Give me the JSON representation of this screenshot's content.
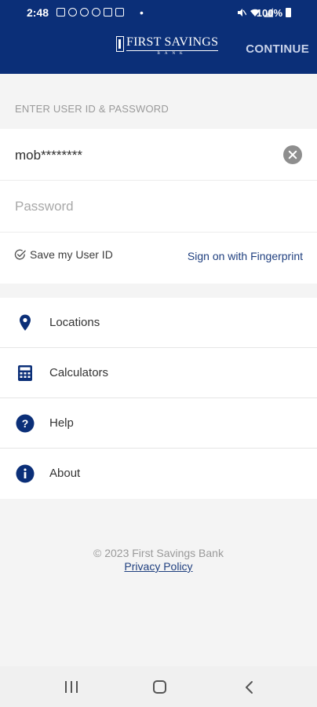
{
  "status_bar": {
    "time": "2:48",
    "dot": "•",
    "battery": "100%"
  },
  "header": {
    "logo_text": "FIRST SAVINGS",
    "logo_subtext": "BANK",
    "continue_label": "CONTINUE",
    "brand_color": "#0b2f78"
  },
  "login": {
    "section_label": "ENTER USER ID & PASSWORD",
    "userid_value": "mob********",
    "password_placeholder": "Password",
    "save_userid_label": "Save my User ID",
    "fingerprint_label": "Sign on with Fingerprint"
  },
  "menu": {
    "items": [
      {
        "label": "Locations",
        "icon": "location-pin-icon"
      },
      {
        "label": "Calculators",
        "icon": "calculator-icon"
      },
      {
        "label": "Help",
        "icon": "help-icon"
      },
      {
        "label": "About",
        "icon": "info-icon"
      }
    ]
  },
  "footer": {
    "copyright": "© 2023 First Savings Bank",
    "privacy_label": "Privacy Policy"
  },
  "nav_bar": {
    "icons": [
      "recents-icon",
      "home-icon",
      "back-icon"
    ]
  }
}
